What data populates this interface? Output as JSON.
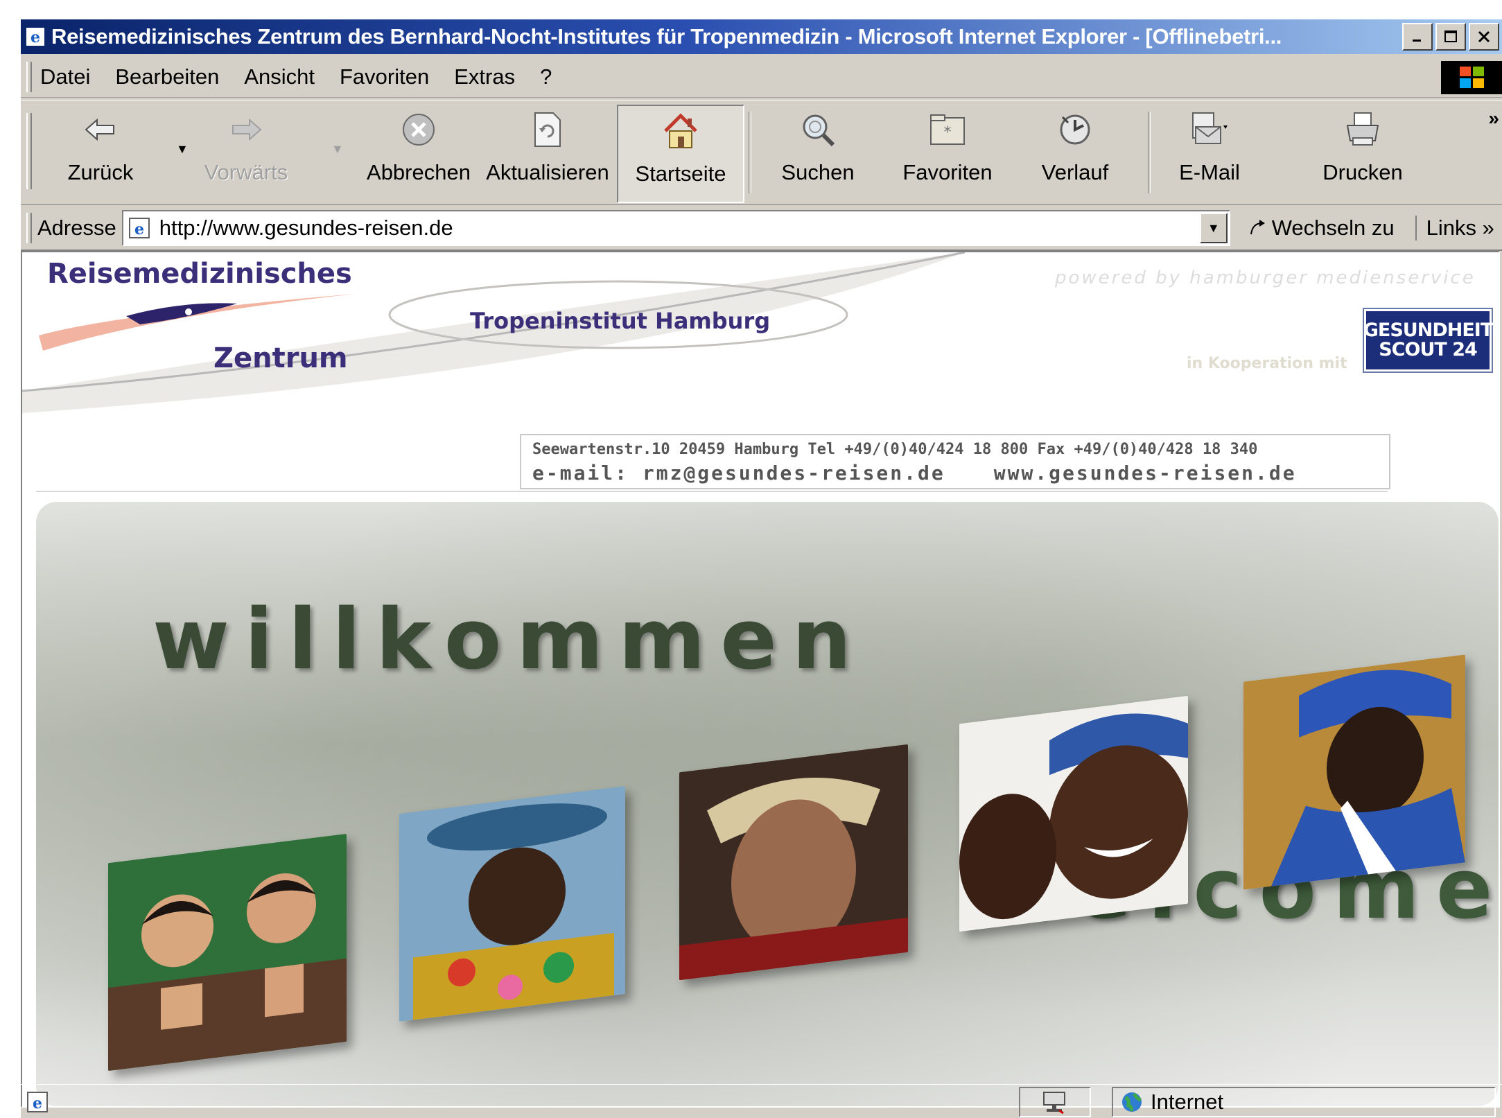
{
  "window": {
    "title": "Reisemedizinisches Zentrum des Bernhard-Nocht-Institutes für Tropenmedizin - Microsoft Internet Explorer - [Offlinebetri...",
    "buttons": [
      "_",
      "□",
      "×"
    ]
  },
  "menu": [
    "Datei",
    "Bearbeiten",
    "Ansicht",
    "Favoriten",
    "Extras",
    "?"
  ],
  "toolbar": {
    "back": "Zurück",
    "forward": "Vorwärts",
    "stop": "Abbrechen",
    "refresh": "Aktualisieren",
    "home": "Startseite",
    "search": "Suchen",
    "favorites": "Favoriten",
    "history": "Verlauf",
    "mail": "E-Mail",
    "print": "Drucken",
    "more": "»"
  },
  "address": {
    "label": "Adresse",
    "url": "http://www.gesundes-reisen.de",
    "go": "Wechseln zu",
    "links": "Links »"
  },
  "page": {
    "logo_line1": "Reisemedizinisches",
    "logo_line2": "Zentrum",
    "tropeninstitut": "Tropeninstitut Hamburg",
    "powered": "powered by hamburger medienservice",
    "kooperation": "in Kooperation mit",
    "scout_line1": "GESUNDHEIT",
    "scout_line2": "SCOUT 24",
    "contact_line1": "Seewartenstr.10   20459 Hamburg   Tel +49/(0)40/424 18 800   Fax +49/(0)40/428 18 340",
    "email": "e-mail: rmz@gesundes-reisen.de",
    "web": "www.gesundes-reisen.de",
    "willkommen": "willkommen",
    "welcome": "welcome"
  },
  "status": {
    "zone": "Internet"
  },
  "colors": {
    "title_gradient_start": "#0a246a",
    "title_gradient_end": "#a6caf0",
    "chrome": "#d4d0c8",
    "logo_purple": "#3b2f7a",
    "scout_blue": "#1c2d7a"
  }
}
